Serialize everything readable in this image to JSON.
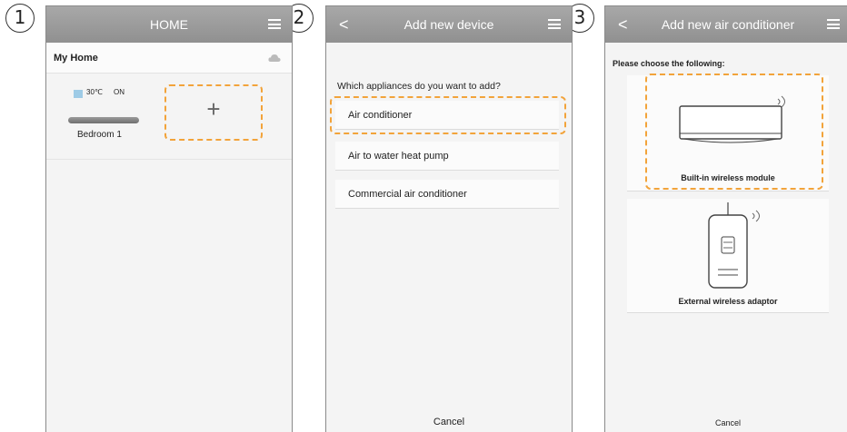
{
  "steps": [
    "1",
    "2",
    "3"
  ],
  "screen1": {
    "title": "HOME",
    "home_name": "My Home",
    "device": {
      "temperature": "30℃",
      "power": "ON",
      "name": "Bedroom 1"
    },
    "add_symbol": "+"
  },
  "screen2": {
    "title": "Add new device",
    "back": "<",
    "question": "Which appliances do you want to add?",
    "options": [
      "Air conditioner",
      "Air to water heat pump",
      "Commercial air conditioner"
    ],
    "cancel": "Cancel"
  },
  "screen3": {
    "title": "Add new air conditioner",
    "back": "<",
    "prompt": "Please choose the following:",
    "options": [
      "Built-in wireless module",
      "External wireless adaptor"
    ],
    "cancel": "Cancel"
  },
  "colors": {
    "highlight": "#f2a33a",
    "navbar": "#9c9c9c"
  }
}
